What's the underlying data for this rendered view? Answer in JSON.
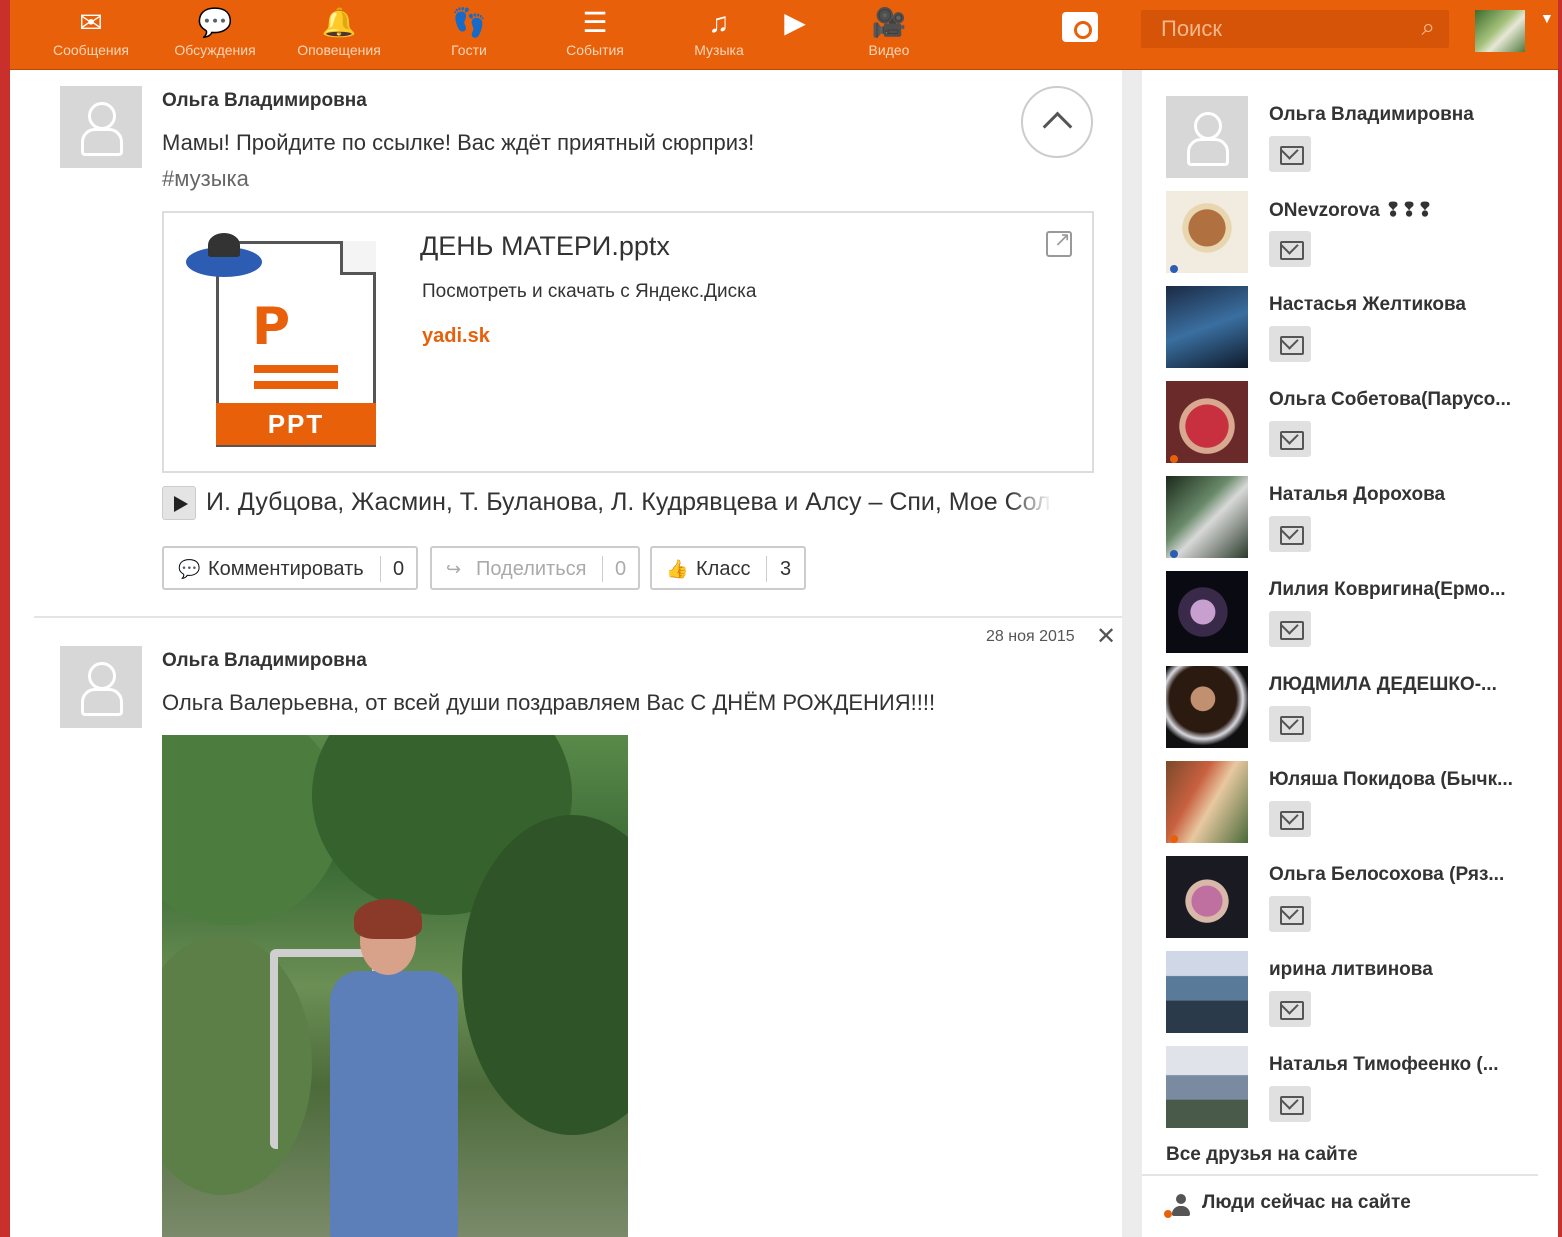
{
  "nav": {
    "items": [
      {
        "label": "Сообщения",
        "icon": "envelope-icon"
      },
      {
        "label": "Обсуждения",
        "icon": "chat-icon"
      },
      {
        "label": "Оповещения",
        "icon": "bell-icon"
      },
      {
        "label": "Гости",
        "icon": "guests-icon"
      },
      {
        "label": "События",
        "icon": "events-icon"
      },
      {
        "label": "Музыка",
        "icon": "music-icon"
      },
      {
        "label": "Видео",
        "icon": "video-icon"
      }
    ],
    "search_placeholder": "Поиск",
    "accent_color": "#e8610a"
  },
  "feed": {
    "post1": {
      "author": "Ольга Владимировна",
      "text": "Мамы! Пройдите по ссылке! Вас ждёт приятный сюрприз!",
      "hashtag": "#музыка",
      "card": {
        "title": "ДЕНЬ МАТЕРИ.pptx",
        "subtitle": "Посмотреть и скачать с Яндекс.Диска",
        "domain": "yadi.sk",
        "file_badge": "PPT"
      },
      "music": "И. Дубцова, Жасмин, Т. Буланова, Л. Кудрявцева и Алсу – Спи, Мое Солнце",
      "actions": {
        "comment_label": "Комментировать",
        "comment_count": "0",
        "share_label": "Поделиться",
        "share_count": "0",
        "like_label": "Класс",
        "like_count": "3"
      }
    },
    "post2": {
      "date": "28 ноя 2015",
      "author": "Ольга Владимировна",
      "text": "Ольга Валерьевна, от всей души поздравляем Вас С ДНЁМ РОЖДЕНИЯ!!!!"
    }
  },
  "sidebar": {
    "friends": [
      {
        "name": "Ольга Владимировна",
        "status": "none"
      },
      {
        "name": "ONevzorova ❢❢❢",
        "status": "blue"
      },
      {
        "name": "Настасья Желтикова",
        "status": "none"
      },
      {
        "name": "Ольга Собетова(Парусо...",
        "status": "orange"
      },
      {
        "name": "Наталья Дорохова",
        "status": "blue"
      },
      {
        "name": "Лилия Ковригина(Ермо...",
        "status": "none"
      },
      {
        "name": "ЛЮДМИЛА ДЕДЕШКО-...",
        "status": "none"
      },
      {
        "name": "Юляша Покидова (Бычк...",
        "status": "orange"
      },
      {
        "name": "Ольга Белосохова (Ряз...",
        "status": "none"
      },
      {
        "name": "ирина литвинова",
        "status": "none"
      },
      {
        "name": "Наталья Тимофеенко (...",
        "status": "none"
      }
    ],
    "all_friends": "Все друзья на сайте",
    "online_people": "Люди сейчас на сайте"
  }
}
